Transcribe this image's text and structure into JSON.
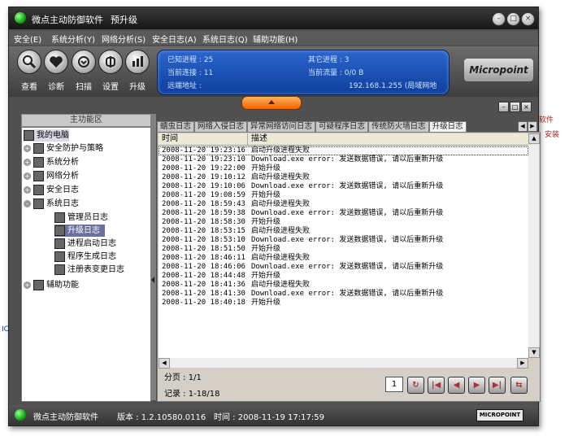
{
  "app": {
    "title": "微点主动防御软件",
    "title_sub": "预升级",
    "window_buttons": [
      "minimize-icon",
      "maximize-icon",
      "close-icon"
    ]
  },
  "background_fragments": [
    "软件",
    "安装",
    "ICK"
  ],
  "menu": [
    "安全(E)",
    "系统分析(Y)",
    "网络分析(S)",
    "安全日志(A)",
    "系统日志(Q)",
    "辅助功能(H)"
  ],
  "toolbar": [
    {
      "label": "查看",
      "icon": "magnifier-icon"
    },
    {
      "label": "诊断",
      "icon": "heart-icon"
    },
    {
      "label": "扫描",
      "icon": "scan-icon"
    },
    {
      "label": "设置",
      "icon": "settings-icon"
    },
    {
      "label": "升级",
      "icon": "upgrade-icon"
    }
  ],
  "status_panel": {
    "known_process_label": "已知进程 : 25",
    "other_process_label": "其它进程 : 3",
    "connections_label": "当前连接 : 11",
    "traffic_label": "当前流量 : 0/0 B",
    "remote_label": "远端地址 :",
    "remote_value": "192.168.1.255 (局域网地"
  },
  "logo_text": "Micropoint",
  "left_panel": {
    "header": "主功能区",
    "tree": [
      {
        "label": "我的电脑",
        "level": 0,
        "expander": "",
        "icon": "computer-icon"
      },
      {
        "label": "安全防护与策略",
        "level": 1,
        "expander": "+",
        "icon": "shield-icon"
      },
      {
        "label": "系统分析",
        "level": 1,
        "expander": "+",
        "icon": "monitor-icon"
      },
      {
        "label": "网络分析",
        "level": 1,
        "expander": "+",
        "icon": "network-icon"
      },
      {
        "label": "安全日志",
        "level": 1,
        "expander": "+",
        "icon": "log-icon"
      },
      {
        "label": "系统日志",
        "level": 1,
        "expander": "-",
        "icon": "log-icon"
      },
      {
        "label": "管理员日志",
        "level": 2,
        "expander": "",
        "icon": "admin-icon"
      },
      {
        "label": "升级日志",
        "level": 2,
        "expander": "",
        "icon": "upgrade-log-icon",
        "selected": true
      },
      {
        "label": "进程启动日志",
        "level": 2,
        "expander": "",
        "icon": "process-icon"
      },
      {
        "label": "程序生成日志",
        "level": 2,
        "expander": "",
        "icon": "program-icon"
      },
      {
        "label": "注册表变更日志",
        "level": 2,
        "expander": "",
        "icon": "registry-icon"
      },
      {
        "label": "辅助功能",
        "level": 0,
        "expander": "+",
        "icon": "helper-icon"
      }
    ]
  },
  "tabs": [
    "蠕虫日志",
    "网络入侵日志",
    "异常网络访问日志",
    "可疑程序日志",
    "传统防火墙日志",
    "升级日志"
  ],
  "active_tab": 5,
  "log_table": {
    "columns": [
      "时间",
      "描述"
    ],
    "rows": [
      {
        "time": "2008-11-20 19:23:16",
        "desc": "启动升级进程失败"
      },
      {
        "time": "2008-11-20 19:23:10",
        "desc": "Download.exe error: 发送数据错误, 请以后重新升级"
      },
      {
        "time": "2008-11-20 19:22:00",
        "desc": "开始升级"
      },
      {
        "time": "2008-11-20 19:10:12",
        "desc": "启动升级进程失败"
      },
      {
        "time": "2008-11-20 19:10:06",
        "desc": "Download.exe error: 发送数据错误, 请以后重新升级"
      },
      {
        "time": "2008-11-20 19:08:59",
        "desc": "开始升级"
      },
      {
        "time": "2008-11-20 18:59:43",
        "desc": "启动升级进程失败"
      },
      {
        "time": "2008-11-20 18:59:38",
        "desc": "Download.exe error: 发送数据错误, 请以后重新升级"
      },
      {
        "time": "2008-11-20 18:58:30",
        "desc": "开始升级"
      },
      {
        "time": "2008-11-20 18:53:15",
        "desc": "启动升级进程失败"
      },
      {
        "time": "2008-11-20 18:53:10",
        "desc": "Download.exe error: 发送数据错误, 请以后重新升级"
      },
      {
        "time": "2008-11-20 18:51:50",
        "desc": "开始升级"
      },
      {
        "time": "2008-11-20 18:46:11",
        "desc": "启动升级进程失败"
      },
      {
        "time": "2008-11-20 18:46:06",
        "desc": "Download.exe error: 发送数据错误, 请以后重新升级"
      },
      {
        "time": "2008-11-20 18:44:48",
        "desc": "开始升级"
      },
      {
        "time": "2008-11-20 18:41:36",
        "desc": "启动升级进程失败"
      },
      {
        "time": "2008-11-20 18:41:30",
        "desc": "Download.exe error: 发送数据错误, 请以后重新升级"
      },
      {
        "time": "2008-11-20 18:40:18",
        "desc": "开始升级"
      }
    ]
  },
  "pagination": {
    "page_label": "分页 : 1/1",
    "records_label": "记录 : 1-18/18",
    "page_input": "1",
    "buttons": [
      "refresh-icon",
      "first-page-icon",
      "prev-page-icon",
      "next-page-icon",
      "last-page-icon",
      "export-icon"
    ]
  },
  "statusbar": {
    "app_name": "微点主动防御软件",
    "version": "版本 : 1.2.10580.0116",
    "time": "时间 : 2008-11-19 17:17:59",
    "logo": "MICROPOINT"
  },
  "colors": {
    "accent_blue": "#1a52b8",
    "selected_row": "#6d6fa0",
    "expander_orange": "#f26a00",
    "nav_red": "#a33"
  }
}
